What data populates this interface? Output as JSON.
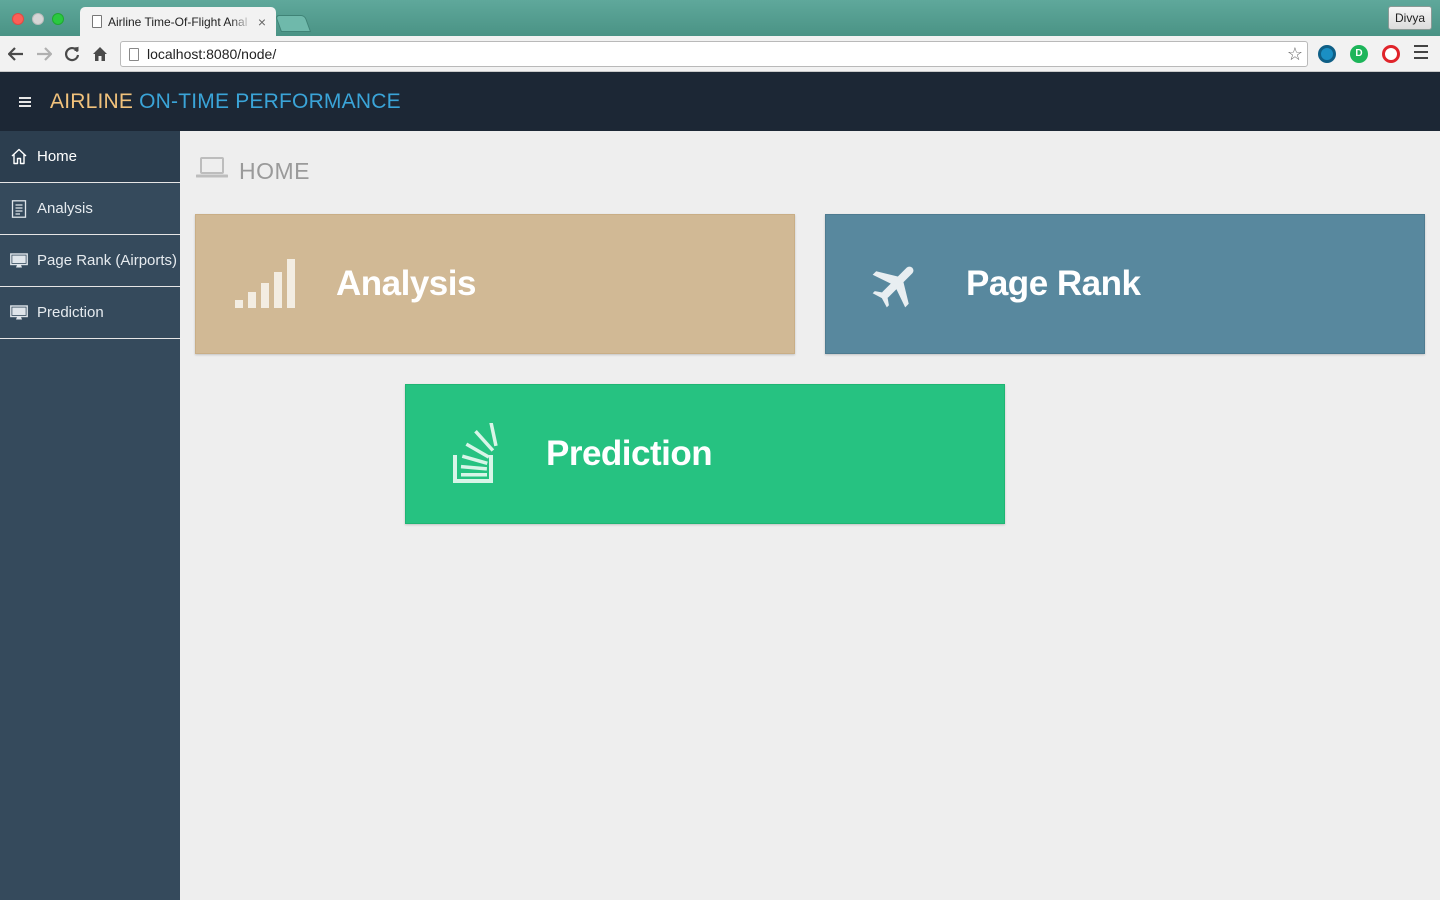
{
  "browser": {
    "tab_title": "Airline Time-Of-Flight Anal",
    "tab_close": "×",
    "profile_name": "Divya",
    "url": "localhost:8080/node/",
    "extension_badge": "D"
  },
  "header": {
    "brand_primary": "AIRLINE",
    "brand_secondary": "ON-TIME PERFORMANCE"
  },
  "sidebar": {
    "items": [
      {
        "label": "Home",
        "icon": "home-icon",
        "active": true
      },
      {
        "label": "Analysis",
        "icon": "document-icon"
      },
      {
        "label": "Page Rank (Airports)",
        "icon": "monitor-icon"
      },
      {
        "label": "Prediction",
        "icon": "monitor-icon"
      }
    ]
  },
  "main": {
    "page_title": "HOME",
    "page_title_icon": "laptop-icon",
    "cards": [
      {
        "label": "Analysis",
        "icon": "signal-bars-icon",
        "color": "#d1b995"
      },
      {
        "label": "Page Rank",
        "icon": "airplane-icon",
        "color": "#58889e"
      },
      {
        "label": "Prediction",
        "icon": "stack-overflow-icon",
        "color": "#26c281"
      }
    ]
  },
  "colors": {
    "header_bg": "#1c2735",
    "sidebar_bg": "#354a5c",
    "brand_primary": "#f1c27c",
    "brand_secondary": "#3aa4d8"
  }
}
